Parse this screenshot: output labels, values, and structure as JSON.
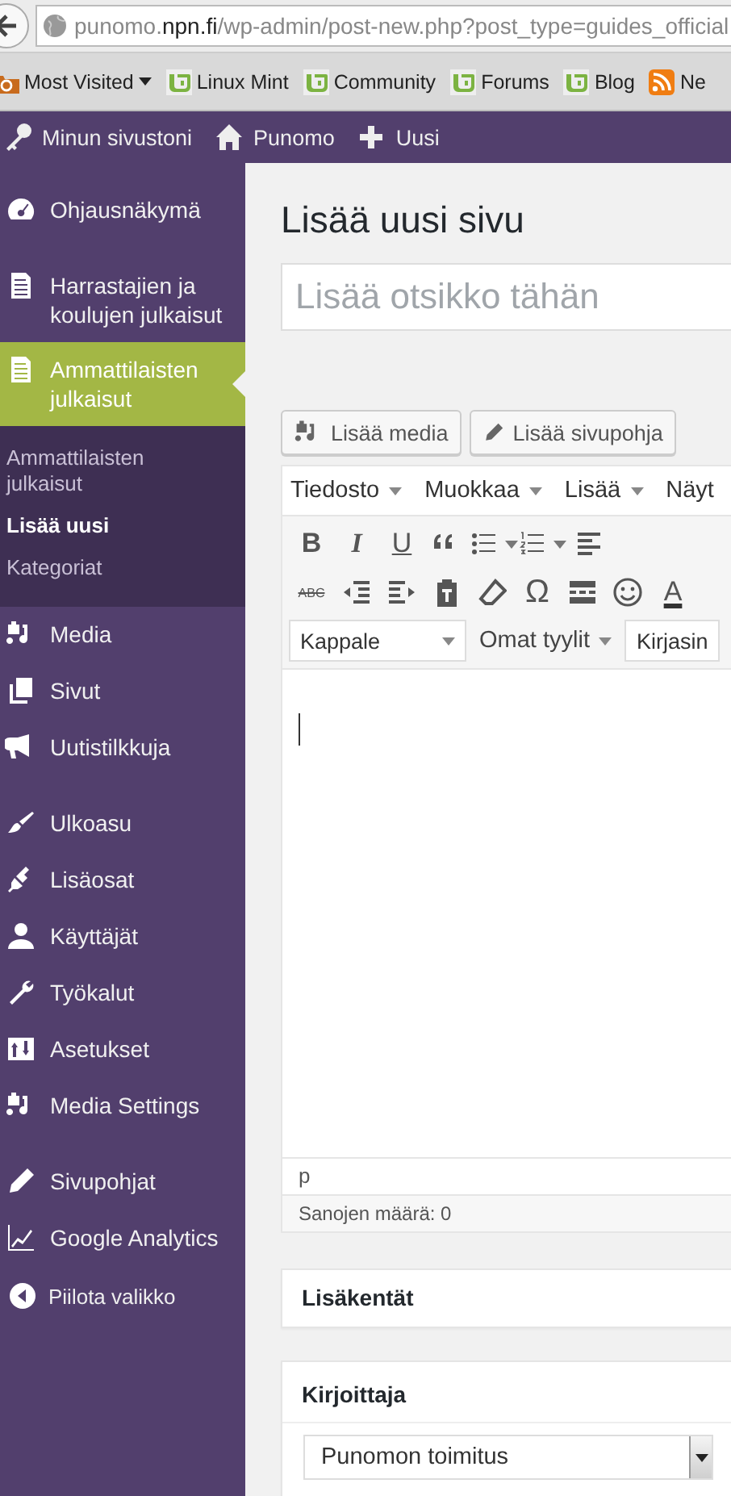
{
  "browser": {
    "url": {
      "prefix": "punomo.",
      "domain": "npn.fi",
      "path": "/wp-admin/post-new.php?post_type=guides_official"
    },
    "bookmarks": [
      {
        "kind": "folder",
        "label": "Most Visited",
        "dropdown": true
      },
      {
        "kind": "mint",
        "label": "Linux Mint"
      },
      {
        "kind": "mint",
        "label": "Community"
      },
      {
        "kind": "mint",
        "label": "Forums"
      },
      {
        "kind": "mint",
        "label": "Blog"
      },
      {
        "kind": "feed",
        "label": "Ne"
      }
    ]
  },
  "admin_bar": [
    {
      "label": "Minun sivustoni"
    },
    {
      "label": "Punomo"
    },
    {
      "label": "Uusi"
    }
  ],
  "sidebar": {
    "groups": [
      [
        {
          "label": "Ohjausnäkymä",
          "selected": false
        }
      ],
      [
        {
          "label": "Harrastajien ja koulujen julkaisut",
          "selected": false
        },
        {
          "label": "Ammattilaisten julkaisut",
          "selected": true,
          "children": [
            {
              "label": "Ammattilaisten julkaisut",
              "selected": false
            },
            {
              "label": "Lisää uusi",
              "selected": true
            },
            {
              "label": "Kategoriat",
              "selected": false
            }
          ]
        },
        {
          "label": "Media",
          "selected": false
        },
        {
          "label": "Sivut",
          "selected": false
        },
        {
          "label": "Uutistilkkuja",
          "selected": false
        }
      ],
      [
        {
          "label": "Ulkoasu",
          "selected": false
        },
        {
          "label": "Lisäosat",
          "selected": false
        },
        {
          "label": "Käyttäjät",
          "selected": false
        },
        {
          "label": "Työkalut",
          "selected": false
        },
        {
          "label": "Asetukset",
          "selected": false
        },
        {
          "label": "Media Settings",
          "selected": false
        }
      ],
      [
        {
          "label": "Sivupohjat",
          "selected": false
        },
        {
          "label": "Google Analytics",
          "selected": false
        }
      ]
    ],
    "collapse": "Piilota valikko"
  },
  "page_title": "Lisää uusi sivu",
  "title_field": {
    "placeholder": "Lisää otsikko tähän"
  },
  "media_buttons": [
    {
      "kind": "media",
      "label": "Lisää media"
    },
    {
      "kind": "template",
      "label": "Lisää sivupohja"
    }
  ],
  "editor": {
    "menus": [
      {
        "label": "Tiedosto",
        "dropdown": true
      },
      {
        "label": "Muokkaa",
        "dropdown": true
      },
      {
        "label": "Lisää",
        "dropdown": true
      },
      {
        "label": "Näyt"
      }
    ],
    "toolbar": [
      [
        {
          "kind": "bold",
          "label": "B"
        },
        {
          "kind": "italic",
          "label": "I"
        },
        {
          "kind": "underline",
          "label": "U"
        },
        {
          "kind": "quote"
        },
        {
          "kind": "bullets",
          "dropdown": true
        },
        {
          "kind": "numbers",
          "dropdown": true
        },
        {
          "kind": "alignleft"
        }
      ],
      [
        {
          "kind": "strike",
          "label": "ABC"
        },
        {
          "kind": "outdent"
        },
        {
          "kind": "indent"
        },
        {
          "kind": "paste"
        },
        {
          "kind": "eraser"
        },
        {
          "kind": "char",
          "label": "Ω"
        },
        {
          "kind": "readmore"
        },
        {
          "kind": "emoji"
        },
        {
          "kind": "textcolor",
          "label": "A"
        }
      ]
    ],
    "format": [
      {
        "kind": "select",
        "value": "Kappale"
      },
      {
        "kind": "menu",
        "label": "Omat tyylit"
      },
      {
        "kind": "select",
        "value": "Kirjasin"
      }
    ],
    "path": "p",
    "word_count": "Sanojen määrä: 0"
  },
  "boxes": [
    {
      "title": "Lisäkentät"
    },
    {
      "title": "Kirjoittaja",
      "select": "Punomon toimitus"
    }
  ]
}
